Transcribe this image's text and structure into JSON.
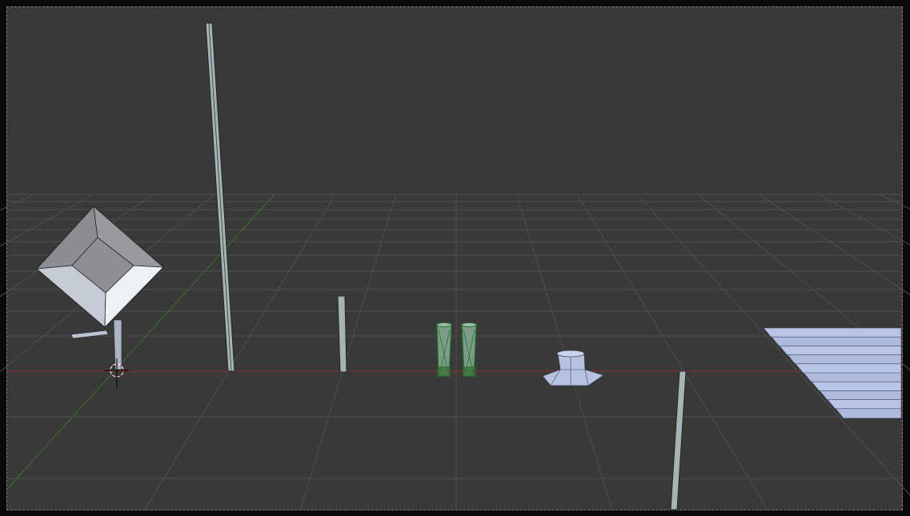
{
  "viewport": {
    "background": "#393939",
    "grid_color": "#4e4e4e",
    "x_axis_color": "#8a2a2a",
    "y_axis_color": "#3d6e2e",
    "object_color": "#b9c3d6",
    "selected_wire_color": "#1e7a2a"
  }
}
